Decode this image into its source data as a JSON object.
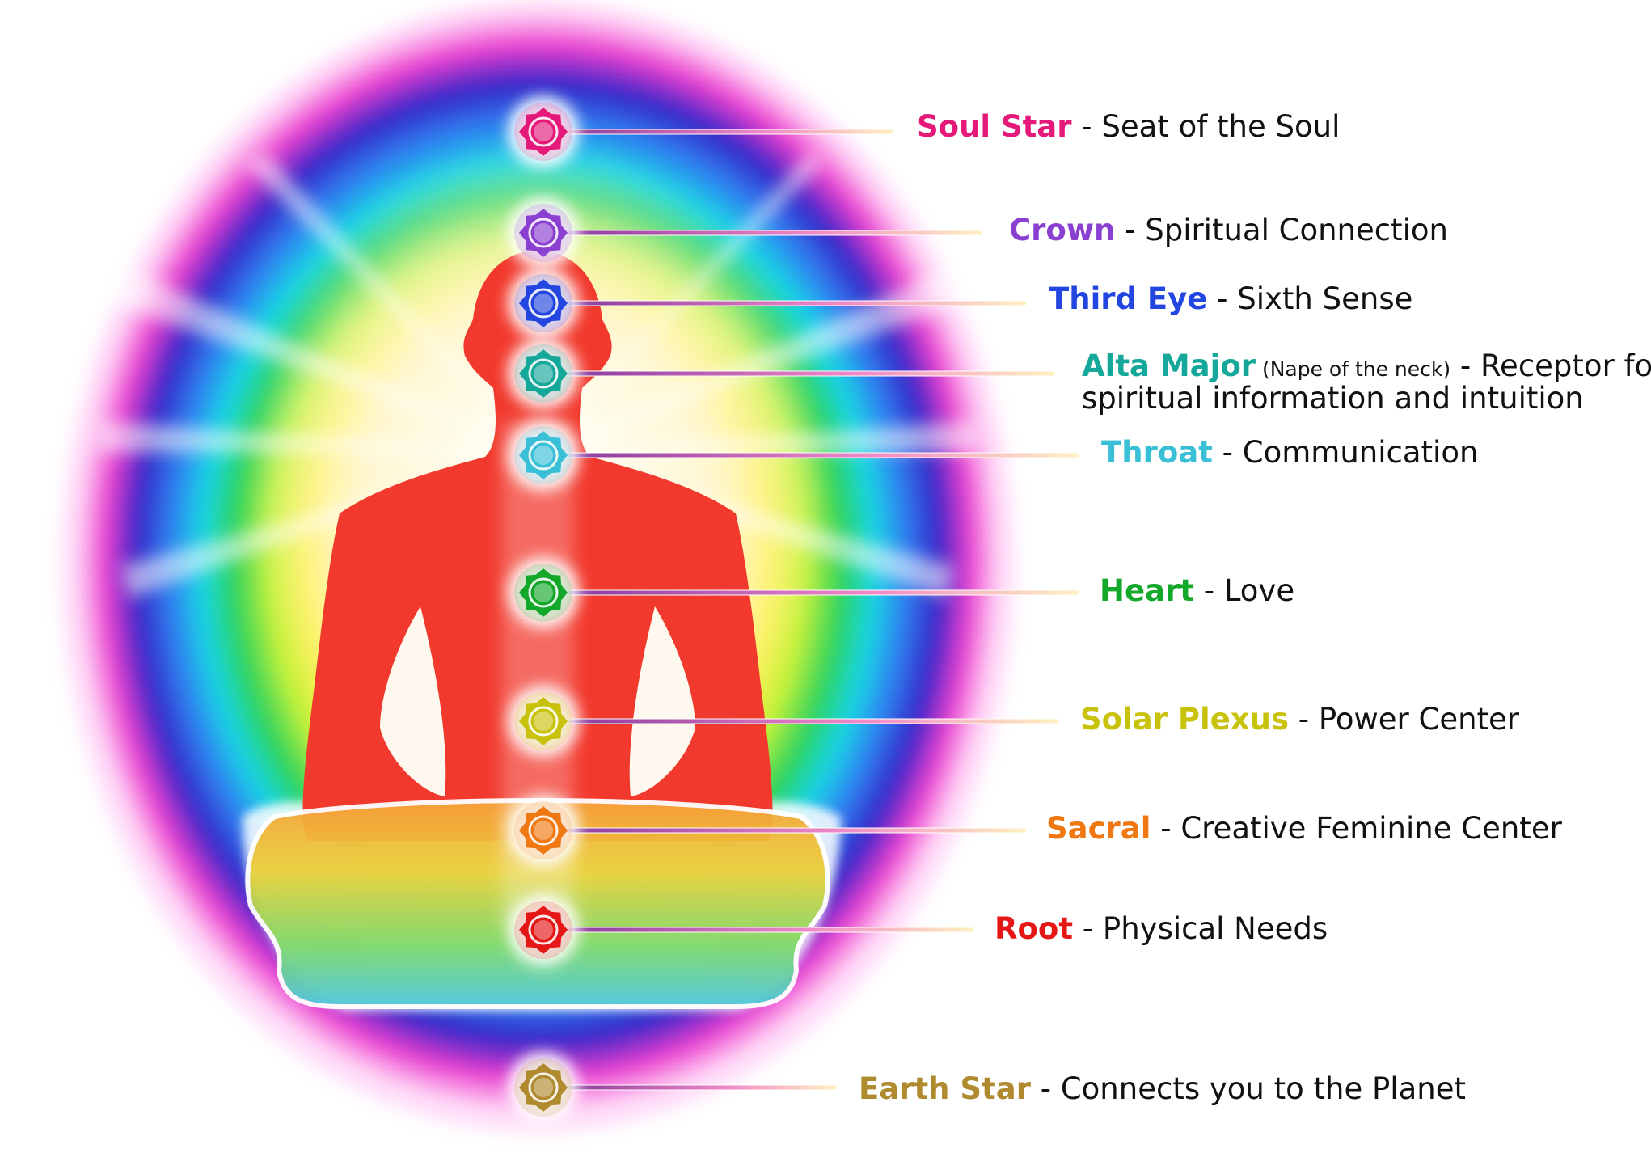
{
  "chakras": [
    {
      "id": "soul-star",
      "name": "Soul Star",
      "separator": " - ",
      "description": "Seat of the Soul",
      "color": "#e5197a"
    },
    {
      "id": "crown",
      "name": "Crown",
      "separator": " - ",
      "description": "Spiritual Connection",
      "color": "#8a3fd1"
    },
    {
      "id": "third-eye",
      "name": "Third Eye",
      "separator": " - ",
      "description": "Sixth Sense",
      "color": "#2446e0"
    },
    {
      "id": "alta-major",
      "name": "Alta Major",
      "note": "(Nape of the neck)",
      "separator": " - ",
      "description": "Receptor for",
      "description_line2": "spiritual information and intuition",
      "color": "#15a89a"
    },
    {
      "id": "throat",
      "name": "Throat",
      "separator": " - ",
      "description": "Communication",
      "color": "#39bfd6"
    },
    {
      "id": "heart",
      "name": "Heart",
      "separator": " - ",
      "description": "Love",
      "color": "#14a82a"
    },
    {
      "id": "solar-plexus",
      "name": "Solar Plexus",
      "separator": " - ",
      "description": "Power Center",
      "color": "#c9c20c"
    },
    {
      "id": "sacral",
      "name": "Sacral",
      "separator": " - ",
      "description": "Creative Feminine Center",
      "color": "#f07812"
    },
    {
      "id": "root",
      "name": "Root",
      "separator": " - ",
      "description": "Physical Needs",
      "color": "#e51616"
    },
    {
      "id": "earth-star",
      "name": "Earth Star",
      "separator": " - ",
      "description": "Connects you to the Planet",
      "color": "#b08a2e"
    }
  ],
  "colors": {
    "figure": "#f2392d",
    "ring_palette": [
      "#ff3fd8",
      "#3a2bd6",
      "#19c7ee",
      "#22c96a",
      "#d8f20a",
      "#ffd21a"
    ]
  }
}
